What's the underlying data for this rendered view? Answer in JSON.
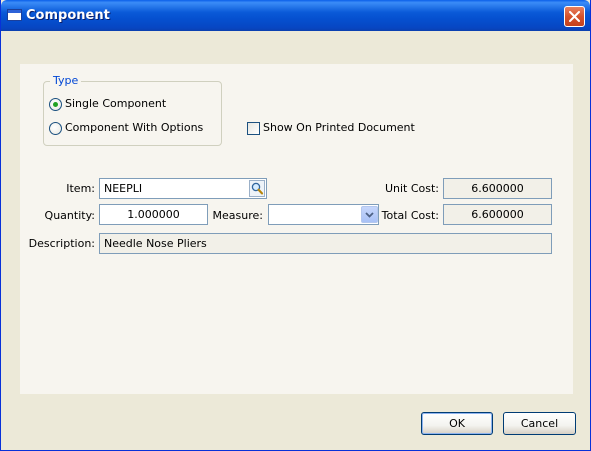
{
  "window": {
    "title": "Component"
  },
  "type_group": {
    "legend": "Type",
    "options": [
      {
        "label": "Single Component",
        "checked": true
      },
      {
        "label": "Component With Options",
        "checked": false
      }
    ]
  },
  "show_on_printed": {
    "label": "Show On Printed Document",
    "checked": false
  },
  "fields": {
    "item": {
      "label": "Item:",
      "value": "NEEPLI"
    },
    "quantity": {
      "label": "Quantity:",
      "value": "1.000000"
    },
    "measure": {
      "label": "Measure:",
      "value": ""
    },
    "description": {
      "label": "Description:",
      "value": "Needle Nose Pliers"
    },
    "unit_cost": {
      "label": "Unit Cost:",
      "value": "6.600000"
    },
    "total_cost": {
      "label": "Total Cost:",
      "value": "6.600000"
    }
  },
  "buttons": {
    "ok": "OK",
    "cancel": "Cancel"
  },
  "colors": {
    "titlebar": "#0a5ad8",
    "legend": "#0046d5",
    "radio_dot": "#21a121",
    "close": "#d5522c"
  },
  "icons": {
    "window": "window-icon",
    "close": "close-icon",
    "lookup": "magnifier-icon",
    "dropdown": "chevron-down-icon"
  }
}
